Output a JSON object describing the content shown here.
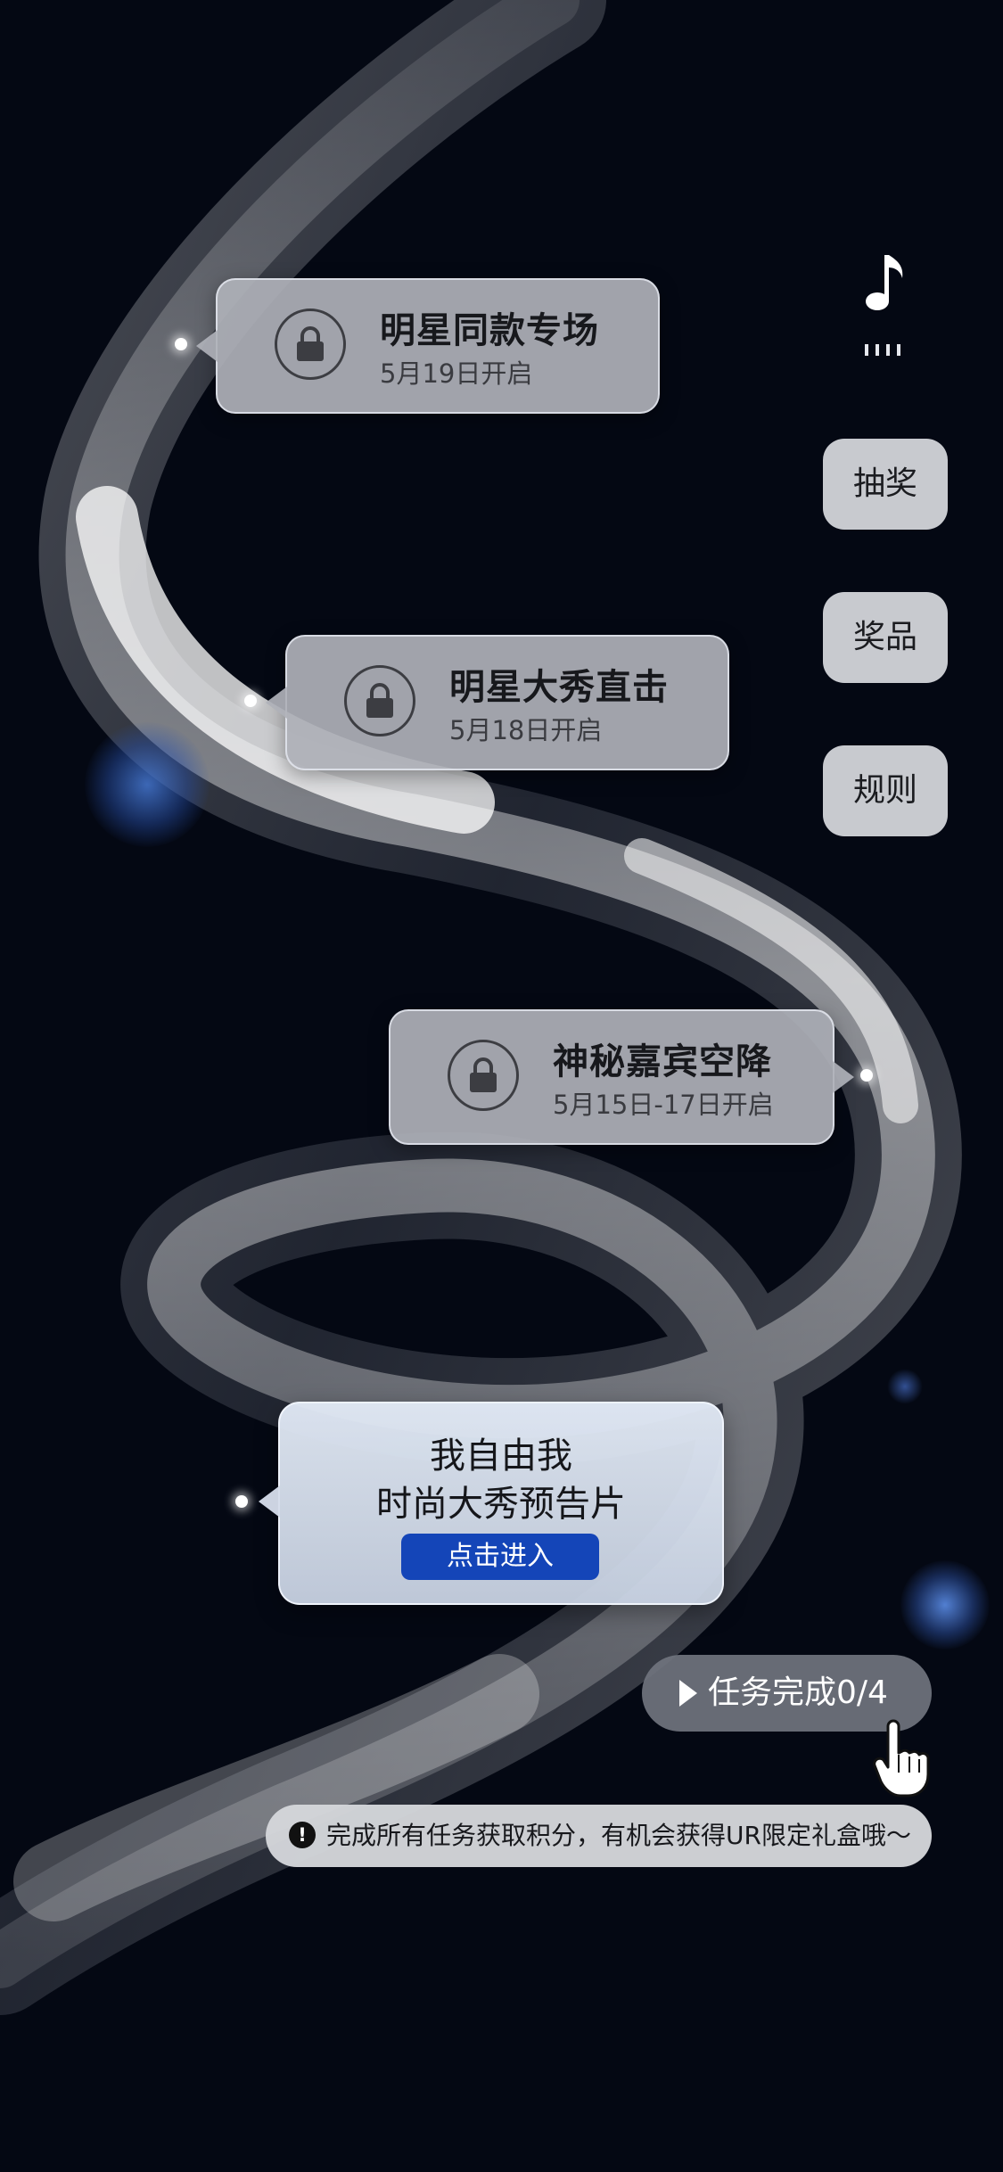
{
  "milestones": [
    {
      "title": "明星同款专场",
      "date": "5月19日开启",
      "status_icon": "lock-icon"
    },
    {
      "title": "明星大秀直击",
      "date": "5月18日开启",
      "status_icon": "lock-icon"
    },
    {
      "title": "神秘嘉宾空降",
      "date": "5月15日-17日开启",
      "status_icon": "lock-icon"
    }
  ],
  "feature": {
    "line1": "我自由我",
    "line2": "时尚大秀预告片",
    "enter_label": "点击进入"
  },
  "side_menu": {
    "music_icon": "music-note-icon",
    "items": [
      "抽奖",
      "奖品",
      "规则"
    ]
  },
  "task": {
    "label": "任务完成0/4",
    "completed": 0,
    "total": 4
  },
  "notice": {
    "icon": "alert-icon",
    "text": "完成所有任务获取积分，有机会获得UR限定礼盒哦～"
  },
  "colors": {
    "background": "#040813",
    "accent_button": "#1445b8",
    "bubble": "#afb1b8"
  }
}
